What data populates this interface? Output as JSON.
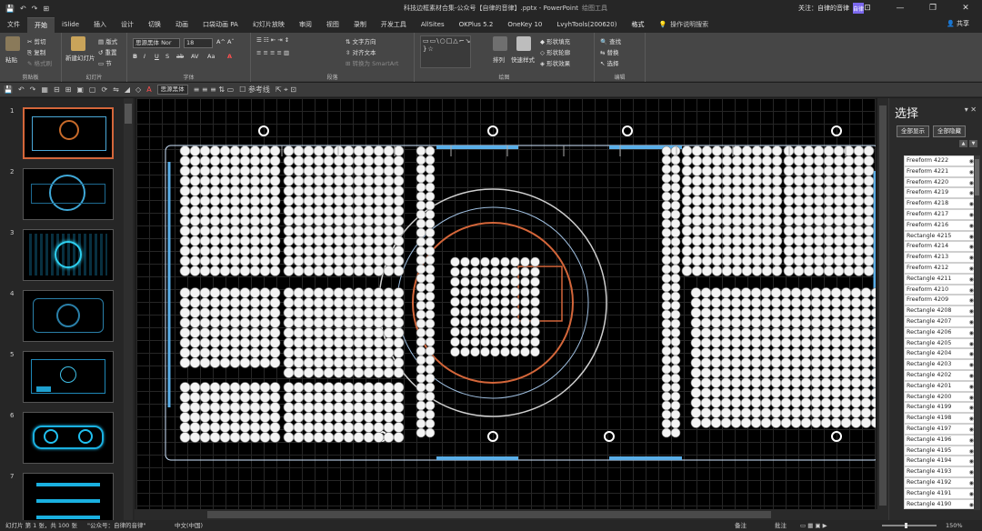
{
  "window": {
    "title": "科技边框素材合集-公众号【自律的音律】.pptx - PowerPoint",
    "context_tab_group": "绘图工具",
    "account_label": "关注：自律的音律",
    "avatar_text": "自律",
    "minimize": "—",
    "maximize": "❐",
    "close": "✕"
  },
  "quick_access": [
    "💾",
    "↶",
    "↷",
    "⊞"
  ],
  "tabs": [
    {
      "label": "文件"
    },
    {
      "label": "开始",
      "active": true
    },
    {
      "label": "iSlide"
    },
    {
      "label": "插入"
    },
    {
      "label": "设计"
    },
    {
      "label": "切换"
    },
    {
      "label": "动画"
    },
    {
      "label": "口袋动画 PA"
    },
    {
      "label": "幻灯片放映"
    },
    {
      "label": "审阅"
    },
    {
      "label": "视图"
    },
    {
      "label": "录制"
    },
    {
      "label": "开发工具"
    },
    {
      "label": "AllSites"
    },
    {
      "label": "OKPlus 5.2"
    },
    {
      "label": "OneKey 10"
    },
    {
      "label": "LvyhTools(200620)"
    },
    {
      "label": "格式"
    }
  ],
  "tell_me": "操作说明搜索",
  "share": "共享",
  "ribbon": {
    "groups": [
      {
        "label": "剪贴板",
        "items": [
          "粘贴",
          "剪切",
          "复制",
          "格式刷"
        ]
      },
      {
        "label": "幻灯片",
        "items": [
          "新建幻灯片",
          "版式",
          "重置",
          "节"
        ]
      },
      {
        "label": "字体",
        "font_name": "思源黑体 Nor",
        "font_size": "18",
        "items": [
          "B",
          "I",
          "U",
          "S",
          "ab",
          "AV",
          "Aa",
          "A"
        ]
      },
      {
        "label": "段落",
        "items": [
          "文字方向",
          "对齐文本",
          "转换为 SmartArt"
        ]
      },
      {
        "label": "绘图",
        "shapes_glyphs": "▭▭\\○□△⌐↘⇨⇧⬠⌒{ }☆",
        "items": [
          "排列",
          "快速样式",
          "形状填充",
          "形状轮廓",
          "形状效果"
        ]
      },
      {
        "label": "编辑",
        "items": [
          "查找",
          "替换",
          "选择"
        ]
      }
    ]
  },
  "qat_toolbar": {
    "font_box": "思源黑体",
    "ref_line": "参考线"
  },
  "slides": [
    {
      "num": "1",
      "selected": true
    },
    {
      "num": "2"
    },
    {
      "num": "3"
    },
    {
      "num": "4"
    },
    {
      "num": "5"
    },
    {
      "num": "6"
    },
    {
      "num": "7"
    }
  ],
  "selection_pane": {
    "title": "选择",
    "close": "✕",
    "menu": "▾",
    "show_all": "全部显示",
    "hide_all": "全部隐藏",
    "up": "▲",
    "down": "▼",
    "items": [
      "Freeform 4222",
      "Freeform 4221",
      "Freeform 4220",
      "Freeform 4219",
      "Freeform 4218",
      "Freeform 4217",
      "Freeform 4216",
      "Rectangle 4215",
      "Freeform 4214",
      "Freeform 4213",
      "Freeform 4212",
      "Rectangle 4211",
      "Freeform 4210",
      "Freeform 4209",
      "Rectangle 4208",
      "Rectangle 4207",
      "Rectangle 4206",
      "Rectangle 4205",
      "Rectangle 4204",
      "Rectangle 4203",
      "Rectangle 4202",
      "Rectangle 4201",
      "Rectangle 4200",
      "Rectangle 4199",
      "Rectangle 4198",
      "Rectangle 4197",
      "Rectangle 4196",
      "Rectangle 4195",
      "Rectangle 4194",
      "Rectangle 4193",
      "Rectangle 4192",
      "Rectangle 4191",
      "Rectangle 4190"
    ]
  },
  "status": {
    "slide_info": "幻灯片 第 1 张，共 100 张",
    "theme": "\"公众号：自律的音律\"",
    "lang": "中文(中国)",
    "notes": "备注",
    "comments": "批注",
    "zoom": "150%"
  },
  "colors": {
    "accent_orange": "#d4663a",
    "frame_blue": "#5aaee8",
    "canvas_bg": "#000000",
    "handle_white": "#ffffff"
  }
}
